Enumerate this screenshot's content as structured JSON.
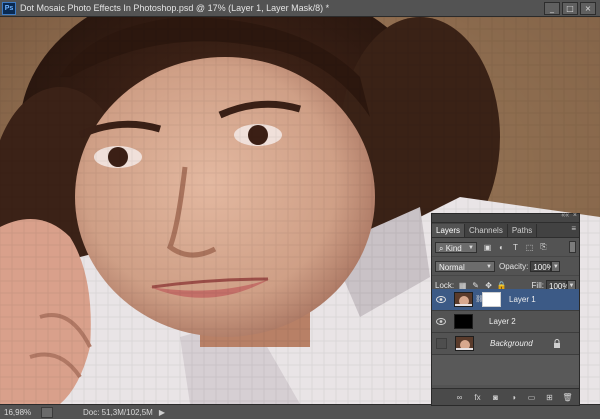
{
  "window": {
    "app_icon": "ps-logo-icon",
    "app_icon_text": "Ps",
    "title": "Dot Mosaic Photo Effects In Photoshop.psd @ 17% (Layer 1, Layer Mask/8) *",
    "buttons": [
      "_",
      "□",
      "×"
    ]
  },
  "canvas": {
    "content": "pixelated-portrait-photo"
  },
  "status_bar": {
    "zoom": "16,98%",
    "doc_info": "Doc: 51,3M/102,5M",
    "arrow": "▶"
  },
  "layers_panel": {
    "collapse_icon": "««",
    "close_icon": "×",
    "menu_icon": "≡",
    "tabs": [
      {
        "label": "Layers",
        "active": true
      },
      {
        "label": "Channels",
        "active": false
      },
      {
        "label": "Paths",
        "active": false
      }
    ],
    "filter": {
      "kind_label": "Kind",
      "search_glyph": "⌕",
      "icons": [
        "image-filter-icon",
        "adjustment-filter-icon",
        "type-filter-icon",
        "shape-filter-icon",
        "smart-object-filter-icon"
      ],
      "icon_glyphs": [
        "▣",
        "◐",
        "T",
        "⬚",
        "⎘"
      ]
    },
    "blend_mode": "Normal",
    "opacity_label": "Opacity:",
    "opacity_value": "100%",
    "lock_label": "Lock:",
    "lock_icons": [
      "lock-transparent-icon",
      "lock-pixels-icon",
      "lock-position-icon",
      "lock-all-icon"
    ],
    "lock_glyphs": [
      "▦",
      "✎",
      "✥",
      "🔒"
    ],
    "fill_label": "Fill:",
    "fill_value": "100%",
    "layers": [
      {
        "name": "Layer 1",
        "visible": true,
        "selected": true,
        "has_mask": true,
        "thumb": "photo"
      },
      {
        "name": "Layer 2",
        "visible": true,
        "selected": false,
        "has_mask": false,
        "thumb": "black"
      },
      {
        "name": "Background",
        "visible": false,
        "selected": false,
        "has_mask": false,
        "thumb": "photo",
        "locked": true
      }
    ],
    "footer_icons": [
      "link-layers-icon",
      "fx-icon",
      "add-mask-icon",
      "adjustment-layer-icon",
      "group-folder-icon",
      "new-layer-icon",
      "trash-icon"
    ],
    "footer_glyphs": [
      "∞",
      "fx",
      "◙",
      "◑",
      "▭",
      "⊞",
      "🗑"
    ],
    "colors": {
      "selected_layer": "#3c5a86",
      "panel_bg": "#535353"
    }
  }
}
